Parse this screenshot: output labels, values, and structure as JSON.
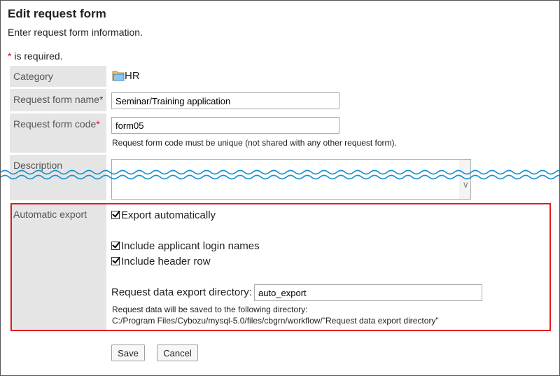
{
  "page": {
    "title": "Edit request form",
    "subtitle": "Enter request form information.",
    "required_star": "*",
    "required_note": " is required."
  },
  "fields": {
    "category": {
      "label": "Category",
      "value": "HR",
      "icon": "folder-icon"
    },
    "name": {
      "label": "Request form name",
      "required_mark": "*",
      "value": "Seminar/Training application"
    },
    "code": {
      "label": "Request form code",
      "required_mark": "*",
      "value": "form05",
      "help": "Request form code must be unique (not shared with any other request form)."
    },
    "description": {
      "label": "Description",
      "value": ""
    }
  },
  "automatic_export": {
    "label": "Automatic export",
    "export_automatically": {
      "label": "Export automatically",
      "checked": true
    },
    "include_login_names": {
      "label": "Include applicant login names",
      "checked": true
    },
    "include_header_row": {
      "label": "Include header row",
      "checked": true
    },
    "directory_label": "Request data export directory:",
    "directory_value": "auto_export",
    "directory_help_1": "Request data will be saved to the following directory:",
    "directory_help_2": "C:/Program Files/Cybozu/mysql-5.0/files/cbgrn/workflow/\"Request data export directory\""
  },
  "buttons": {
    "save": "Save",
    "cancel": "Cancel"
  },
  "colors": {
    "highlight_border": "#e31b23",
    "required": "#e60012",
    "label_bg": "#e5e5e5",
    "wave": "#1a8fd0"
  }
}
